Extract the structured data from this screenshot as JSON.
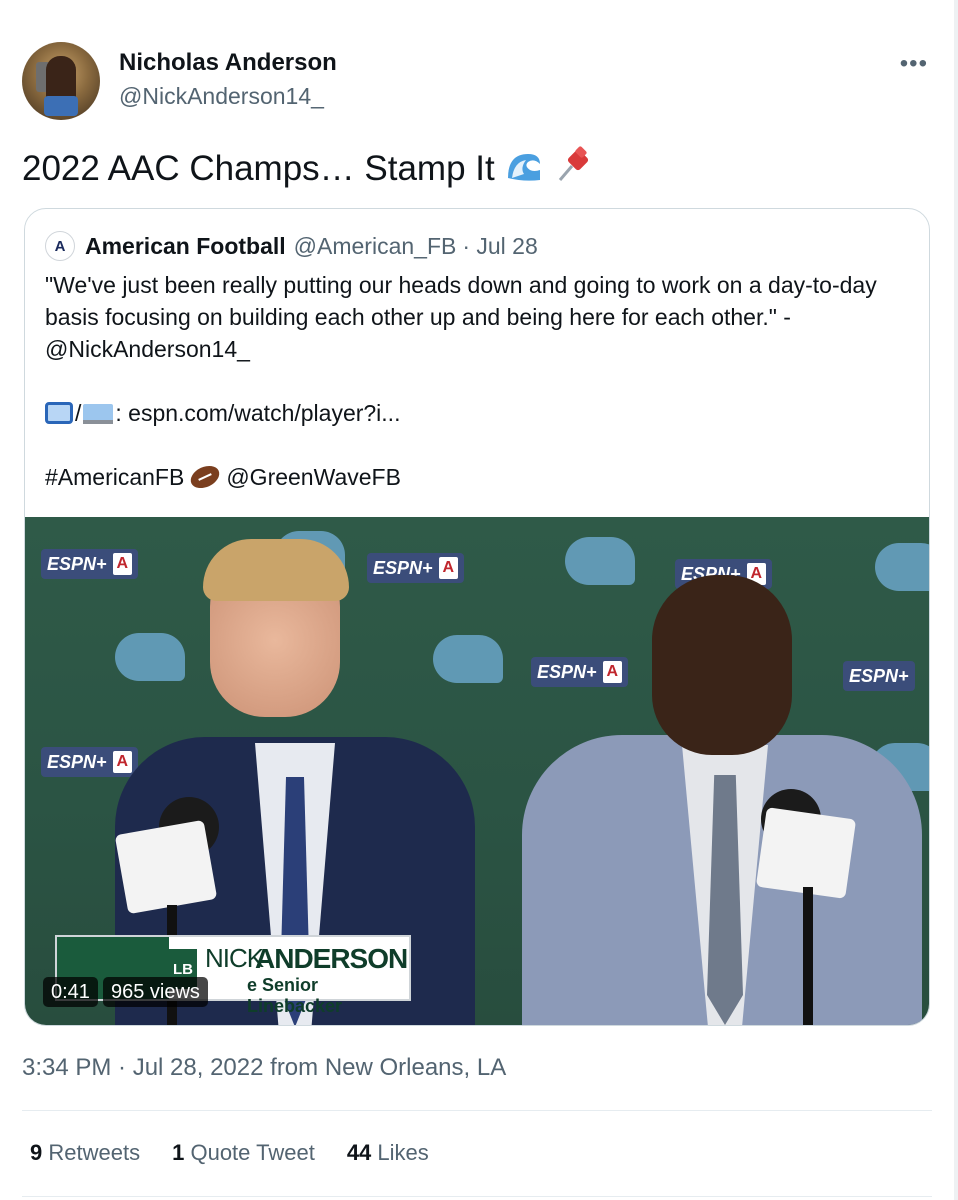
{
  "author": {
    "name": "Nicholas Anderson",
    "handle": "@NickAnderson14_"
  },
  "tweet": {
    "text": "2022 AAC Champs… Stamp It",
    "emojis": [
      "wave-emoji",
      "pushpin-emoji"
    ]
  },
  "more_icon": "•••",
  "quote": {
    "avatar_letter": "A",
    "name": "American Football",
    "handle": "@American_FB",
    "date": "· Jul 28",
    "line1": "\"We've just been really putting our heads down and going to work on a day-to-day basis focusing on building each other up and being here for each other.\" - @NickAnderson14_",
    "watch_separator": "/",
    "watch_text": ": espn.com/watch/player?i...",
    "hashtag": "#AmericanFB",
    "mention": "@GreenWaveFB",
    "video": {
      "lower_third": {
        "position": "LB",
        "first_name": "NICK",
        "last_name": "ANDERSON",
        "subtitle": "e Senior Linebacker"
      },
      "duration": "0:41",
      "views": "965 views",
      "logo_text": "ESPN+",
      "logo_badge": "A"
    }
  },
  "timestamp": "3:34 PM · Jul 28, 2022 from New Orleans, LA",
  "stats": [
    {
      "count": "9",
      "label": "Retweets"
    },
    {
      "count": "1",
      "label": "Quote Tweet"
    },
    {
      "count": "44",
      "label": "Likes"
    }
  ]
}
